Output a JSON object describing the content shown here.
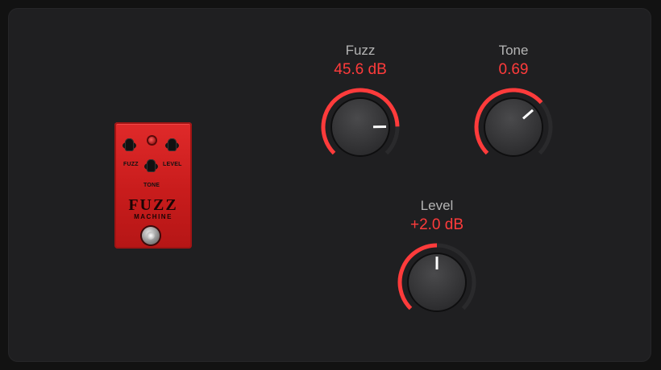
{
  "pedal": {
    "labels": {
      "fuzz": "FUZZ",
      "level": "LEVEL",
      "tone": "TONE"
    },
    "brand_line1": "FUZZ",
    "brand_line2": "MACHINE"
  },
  "controls": {
    "fuzz": {
      "label": "Fuzz",
      "value": "45.6 dB",
      "level": 0.83
    },
    "tone": {
      "label": "Tone",
      "value": "0.69",
      "level": 0.68
    },
    "level": {
      "label": "Level",
      "value": "+2.0 dB",
      "level": 0.5
    }
  },
  "colors": {
    "accent": "#ff3b3b",
    "track": "#2a2a2c",
    "knob": "#3a3a3c"
  }
}
